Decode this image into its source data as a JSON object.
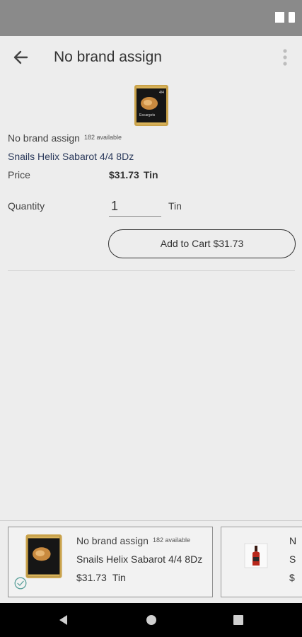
{
  "app_bar": {
    "title": "No brand assign",
    "back_icon": "arrow-left-icon",
    "more_icon": "more-vertical-icon"
  },
  "product": {
    "brand": "No brand assign",
    "availability": "182 available",
    "name": "Snails Helix Sabarot 4/4 8Dz",
    "price_label": "Price",
    "price": "$31.73",
    "unit": "Tin",
    "image_label": "Escargots"
  },
  "quantity": {
    "label": "Quantity",
    "value": "1",
    "unit": "Tin"
  },
  "add_to_cart": {
    "label": "Add to Cart $31.73"
  },
  "tray": {
    "cards": [
      {
        "brand": "No brand assign",
        "availability": "182 available",
        "name": "Snails Helix Sabarot 4/4 8Dz",
        "price": "$31.73",
        "unit": "Tin",
        "selected": true
      },
      {
        "brand_fragment": "N",
        "name_fragment": "S",
        "price_fragment": "$"
      }
    ]
  },
  "colors": {
    "status_bar": "#8a8a8a",
    "background": "#ededed",
    "product_name": "#2b3a5c",
    "check": "#5aa09a",
    "nav_bar": "#000000"
  }
}
